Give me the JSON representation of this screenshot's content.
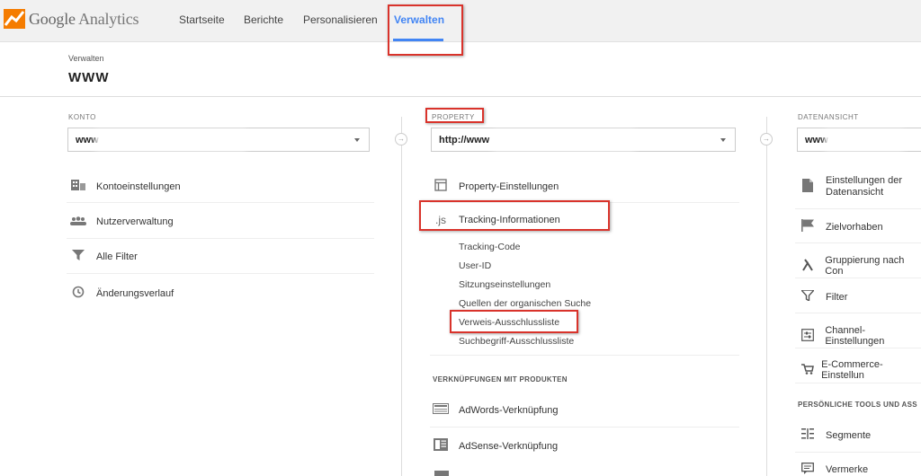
{
  "app": {
    "logo_google": "Google",
    "logo_product": "Analytics"
  },
  "nav": [
    {
      "label": "Startseite"
    },
    {
      "label": "Berichte"
    },
    {
      "label": "Personalisieren"
    },
    {
      "label": "Verwalten"
    }
  ],
  "header": {
    "breadcrumb": "Verwalten",
    "account_title": "WWW"
  },
  "konto": {
    "label": "KONTO",
    "selected": "www",
    "items": [
      {
        "label": "Kontoeinstellungen",
        "icon": "building-icon"
      },
      {
        "label": "Nutzerverwaltung",
        "icon": "users-icon"
      },
      {
        "label": "Alle Filter",
        "icon": "filter-icon"
      },
      {
        "label": "Änderungsverlauf",
        "icon": "history-icon"
      }
    ]
  },
  "property": {
    "label": "PROPERTY",
    "selected": "http://www",
    "items": [
      {
        "label": "Property-Einstellungen",
        "icon": "window-icon"
      },
      {
        "label": "Tracking-Informationen",
        "icon": "js-icon"
      }
    ],
    "tracking_sub": [
      {
        "label": "Tracking-Code"
      },
      {
        "label": "User-ID"
      },
      {
        "label": "Sitzungseinstellungen"
      },
      {
        "label": "Quellen der organischen Suche"
      },
      {
        "label": "Verweis-Ausschlussliste"
      },
      {
        "label": "Suchbegriff-Ausschlussliste"
      }
    ],
    "section_products": "VERKNÜPFUNGEN MIT PRODUKTEN",
    "product_items": [
      {
        "label": "AdWords-Verknüpfung",
        "icon": "adwords-icon"
      },
      {
        "label": "AdSense-Verknüpfung",
        "icon": "adsense-icon"
      }
    ]
  },
  "datenansicht": {
    "label": "DATENANSICHT",
    "selected": "www",
    "items": [
      {
        "label": "Einstellungen der",
        "label2": "Datenansicht",
        "icon": "document-icon"
      },
      {
        "label": "Zielvorhaben",
        "icon": "flag-icon"
      },
      {
        "label": "Gruppierung nach Con",
        "icon": "grouping-icon"
      },
      {
        "label": "Filter",
        "icon": "filter-icon"
      },
      {
        "label": "Channel-Einstellungen",
        "icon": "channel-icon"
      },
      {
        "label": "E-Commerce-Einstellun",
        "icon": "cart-icon"
      }
    ],
    "section_tools": "PERSÖNLICHE TOOLS UND ASS",
    "tool_items": [
      {
        "label": "Segmente",
        "icon": "segments-icon"
      },
      {
        "label": "Vermerke",
        "icon": "comment-icon"
      }
    ]
  },
  "colors": {
    "accent": "#4285f4",
    "highlight": "#d9332b"
  }
}
